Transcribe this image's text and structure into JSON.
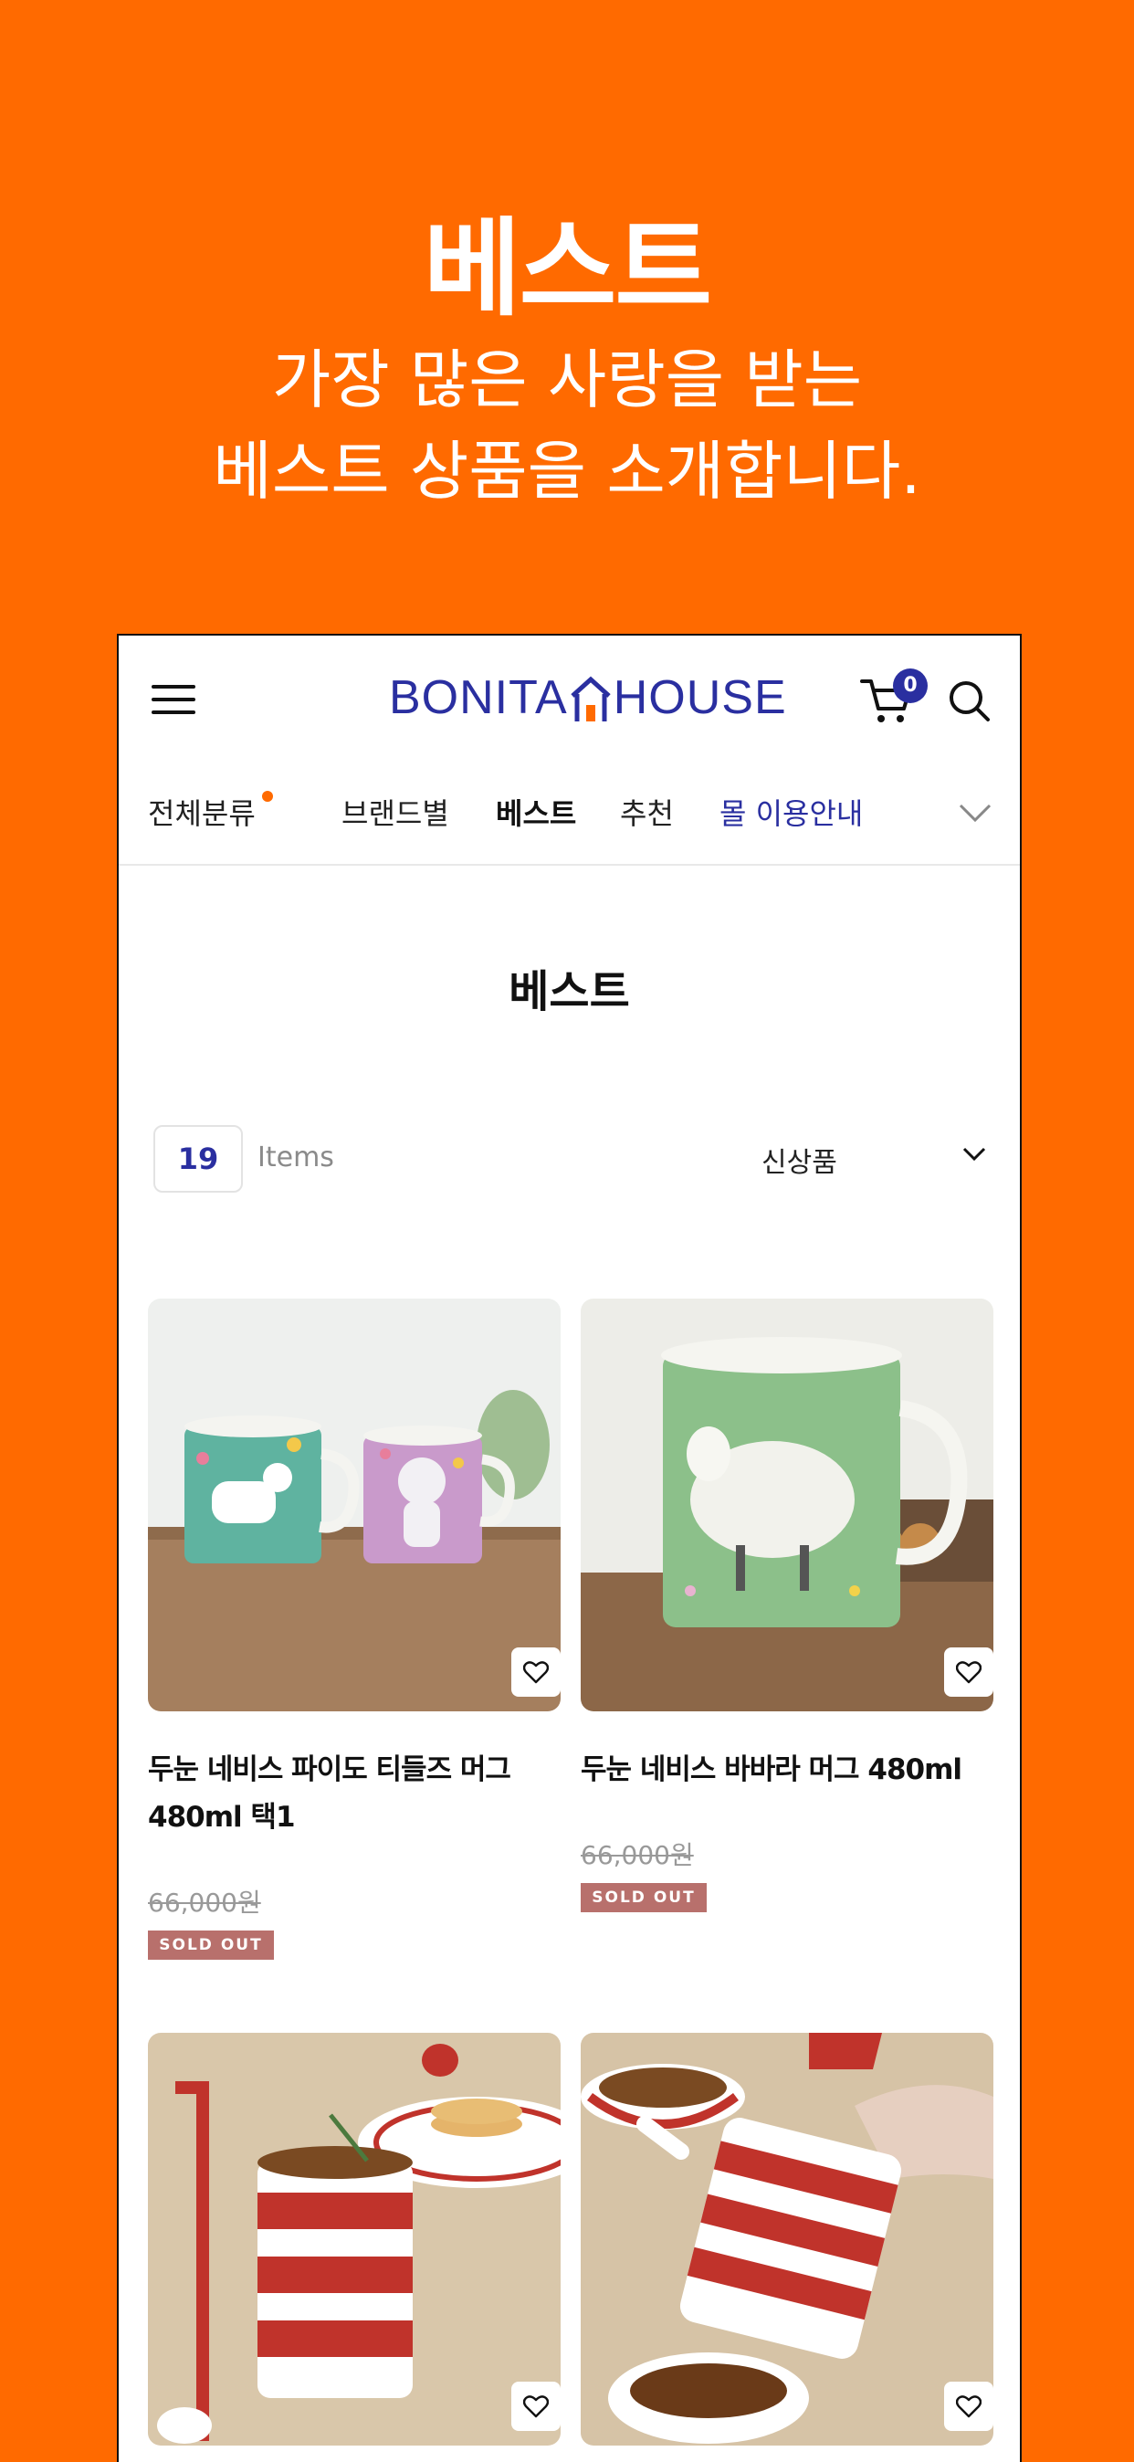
{
  "promo": {
    "title": "베스트",
    "subtitle_line1": "가장 많은 사랑을 받는",
    "subtitle_line2": "베스트 상품을 소개합니다."
  },
  "header": {
    "logo_left": "BONITA",
    "logo_right": "HOUSE",
    "cart_count": "0"
  },
  "nav": {
    "items": [
      "전체분류",
      "브랜드별",
      "베스트",
      "추천",
      "몰 이용안내"
    ]
  },
  "page": {
    "title": "베스트",
    "count": "19",
    "count_label": "Items",
    "sort_selected": "신상품"
  },
  "products": [
    {
      "name": "두눈 네비스 파이도 티들즈 머그 480ml 택1",
      "price": "66,000원",
      "badge": "SOLD OUT"
    },
    {
      "name": "두눈 네비스 바바라 머그 480ml",
      "price": "66,000원",
      "badge": "SOLD OUT"
    },
    {
      "name": "",
      "price": "",
      "badge": ""
    },
    {
      "name": "",
      "price": "",
      "badge": ""
    }
  ],
  "colors": {
    "background": "#FF6A00",
    "brand": "#2A2FA0",
    "sold_out": "#B8706C"
  },
  "icons": [
    "menu-icon",
    "cart-icon",
    "search-icon",
    "chevron-down-icon",
    "heart-icon"
  ]
}
